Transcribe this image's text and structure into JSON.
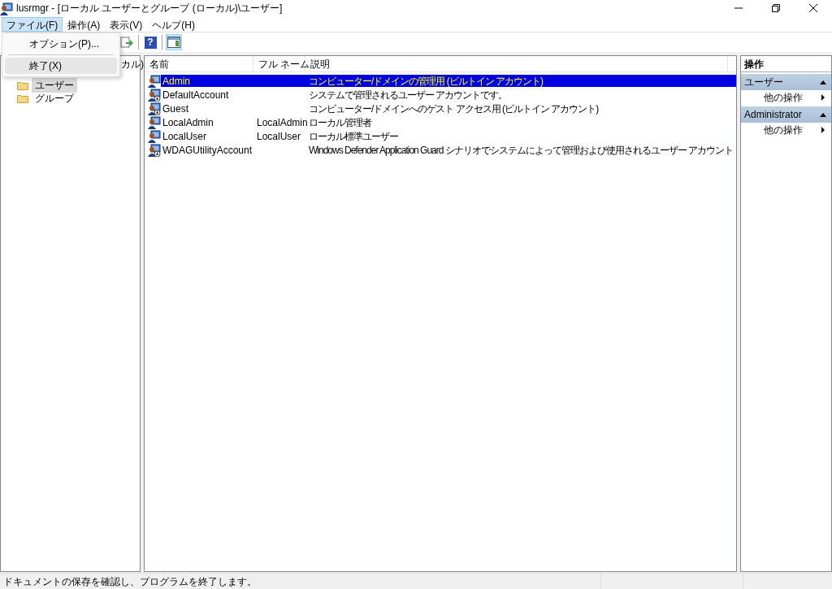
{
  "window": {
    "title": "lusrmgr - [ローカル ユーザーとグループ (ローカル)\\ユーザー]"
  },
  "menu_bar": [
    {
      "label": "ファイル(F)",
      "selected": true
    },
    {
      "label": "操作(A)",
      "selected": false
    },
    {
      "label": "表示(V)",
      "selected": false
    },
    {
      "label": "ヘルプ(H)",
      "selected": false
    }
  ],
  "file_menu": [
    {
      "label": "オプション(P)...",
      "selected": false
    },
    {
      "label": "終了(X)",
      "selected": true
    }
  ],
  "toolbar": [
    {
      "kind": "export",
      "pressed": false
    },
    {
      "kind": "help",
      "pressed": false,
      "glyph": "?"
    },
    {
      "kind": "pane",
      "pressed": true
    }
  ],
  "tree": {
    "label": "カル)",
    "children": [
      {
        "label": "ユーザー",
        "selected": true
      },
      {
        "label": "グループ",
        "selected": false
      }
    ]
  },
  "table": {
    "columns": [
      "名前",
      "フル ネーム",
      "説明"
    ],
    "rows": [
      {
        "name": "Admin",
        "full_name": "",
        "description": "コンピューター/ドメインの管理用 (ビルトイン アカウント)",
        "selected": true,
        "disabled": false
      },
      {
        "name": "DefaultAccount",
        "full_name": "",
        "description": "システムで管理されるユーザー アカウントです。",
        "selected": false,
        "disabled": true
      },
      {
        "name": "Guest",
        "full_name": "",
        "description": "コンピューター/ドメインへのゲスト アクセス用 (ビルトイン アカウント)",
        "selected": false,
        "disabled": true
      },
      {
        "name": "LocalAdmin",
        "full_name": "LocalAdmin",
        "description": "ローカル管理者",
        "selected": false,
        "disabled": false
      },
      {
        "name": "LocalUser",
        "full_name": "LocalUser",
        "description": "ローカル標準ユーザー",
        "selected": false,
        "disabled": false
      },
      {
        "name": "WDAGUtilityAccount",
        "full_name": "",
        "description": "Windows Defender Application Guard シナリオでシステムによって管理および使用されるユーザー アカウント",
        "selected": false,
        "disabled": true
      }
    ]
  },
  "actions": {
    "title": "操作",
    "sections": [
      {
        "title": "ユーザー",
        "items": [
          "他の操作"
        ]
      },
      {
        "title": "Administrator",
        "items": [
          "他の操作"
        ]
      }
    ]
  },
  "status_bar": "ドキュメントの保存を確認し、プログラムを終了します。"
}
